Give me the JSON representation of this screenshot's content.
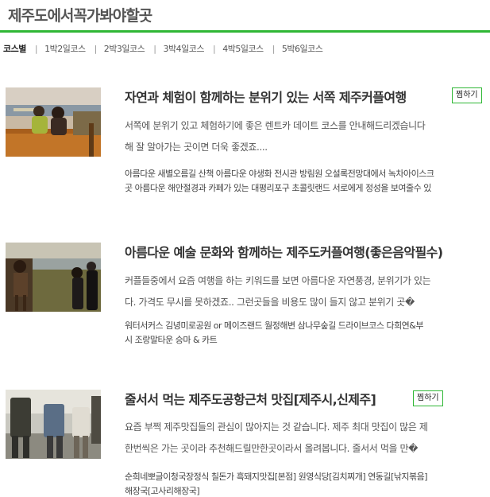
{
  "page": {
    "title": "제주도에서꼭가봐야할곳"
  },
  "nav": {
    "items": [
      {
        "label": "코스별"
      },
      {
        "label": "1박2일코스"
      },
      {
        "label": "2박3일코스"
      },
      {
        "label": "3박4일코스"
      },
      {
        "label": "4박5일코스"
      },
      {
        "label": "5박6일코스"
      }
    ],
    "separator": "|"
  },
  "cards": [
    {
      "title": "자연과 체험이 함께하는 분위기 있는 서쪽 제주커플여행",
      "zzim_label": "찜하기",
      "desc": [
        "서쪽에 분위기 있고 체험하기에 좋은 렌트카 데이트 코스를 안내해드리겠습니다",
        "해 잘 알아가는 곳이면 더욱 좋겠죠...."
      ],
      "spots": [
        "아름다운 새별오름길 산책    아름다운 야생화 전시관 방림원    오설록전망대에서 녹차아이스크",
        "곳    아름다운 해안절경과 카페가 있는 대평리포구    초콜릿랜드 서로에게 정성을 보여줄수 있"
      ]
    },
    {
      "title": "아름다운 예술 문화와 함께하는 제주도커플여행(좋은음악필수)",
      "zzim_label": "",
      "desc": [
        "커플들중에서 요즘 여행을 하는 키워드를 보면 아름다운 자연풍경, 분위기가 있는",
        "다. 가격도 무시를 못하겠죠.. 그런곳들을 비용도 많이 들지 않고 분위기 곳�"
      ],
      "spots": [
        "워터서커스    김녕미로공원 or 메이즈랜드    월정해변    삼나무숲길 드라이브코스    다희연&부",
        "시    조랑말타운 승마 & 카트"
      ]
    },
    {
      "title": "줄서서 먹는 제주도공항근처 맛집[제주시,신제주]",
      "zzim_label": "찜하기",
      "desc": [
        "요즘 부쩍 제주맛집들의 관심이 많아지는 것 같습니다. 제주 최대 맛집이 많은 제",
        "한번씩은 가는 곳이라 추천해드릴만한곳이라서 올려봅니다. 줄서서 먹을 만�"
      ],
      "spots": [
        "순희네뽀글이청국장정식    칠돈가 흑돼지맛집[본점]    원영식당[김치찌개]    연동길[낚지볶음]",
        "해장국[고사리해장국]"
      ]
    }
  ],
  "colors": {
    "accent": "#2fb735",
    "title": "#555555",
    "text": "#333333"
  }
}
